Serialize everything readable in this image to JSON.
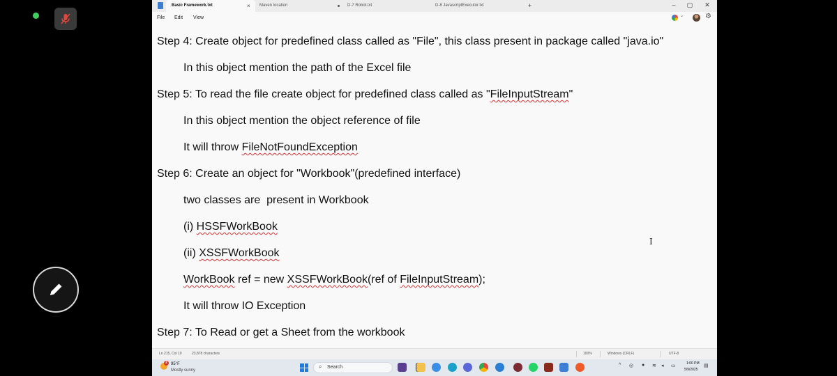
{
  "meeting": {
    "mic_icon": "mic-off-icon",
    "pen_icon": "pencil-icon",
    "colors": {
      "live_dot": "#3ecf5e",
      "mic_bg": "#3a3a3a",
      "mic_slash": "#e0483e"
    }
  },
  "notepad": {
    "tabs": [
      {
        "label": "Basic Framework.txt",
        "state": "active",
        "close": "×"
      },
      {
        "label": "Maven location",
        "state": "inactive"
      },
      {
        "label": "D-7 Robot.txt",
        "state": "modified"
      },
      {
        "label": "D-8 JavascriptExecutor.txt",
        "state": "inactive"
      }
    ],
    "new_tab_label": "+",
    "window_controls": {
      "minimize": "–",
      "maximize": "▢",
      "close": "✕"
    },
    "menu": [
      "File",
      "Edit",
      "View"
    ],
    "lines": [
      {
        "segments": [
          {
            "text": "Step 4: Create object for predefined class called as \"File\", this class present in package called \"java.io\""
          }
        ]
      },
      {
        "segments": [
          {
            "text": "In this object mention the path of the Excel file"
          }
        ]
      },
      {
        "segments": [
          {
            "text": "Step 5: To read the file create object for predefined class called as \""
          },
          {
            "text": "FileInputStream",
            "squiggle": true
          },
          {
            "text": "\""
          }
        ]
      },
      {
        "segments": [
          {
            "text": "In this object mention the object reference of file"
          }
        ]
      },
      {
        "segments": [
          {
            "text": "It will throw "
          },
          {
            "text": "FileNotFoundException",
            "squiggle": true
          }
        ]
      },
      {
        "segments": [
          {
            "text": "Step 6: Create an object for \"Workbook\"(predefined interface)"
          }
        ]
      },
      {
        "segments": [
          {
            "text": "two classes are  present in Workbook"
          }
        ]
      },
      {
        "segments": [
          {
            "text": "(i) "
          },
          {
            "text": "HSSFWorkBook",
            "squiggle": true
          }
        ]
      },
      {
        "segments": [
          {
            "text": "(ii) "
          },
          {
            "text": "XSSFWorkBook",
            "squiggle": true
          }
        ]
      },
      {
        "segments": [
          {
            "text": "WorkBook",
            "squiggle": true
          },
          {
            "text": " ref = new "
          },
          {
            "text": "XSSFWorkBook",
            "squiggle": true
          },
          {
            "text": "(ref of "
          },
          {
            "text": "FileInputStream",
            "squiggle": true
          },
          {
            "text": ");"
          }
        ]
      },
      {
        "segments": [
          {
            "text": "It will throw IO Exception"
          }
        ]
      },
      {
        "segments": [
          {
            "text": "Step 7: To Read or get a Sheet from the workbook"
          }
        ]
      }
    ],
    "status": {
      "position": "Ln 215, Col 10",
      "characters": "23,878 characters",
      "zoom": "100%",
      "line_ending": "Windows (CRLF)",
      "encoding": "UTF-8"
    }
  },
  "taskbar": {
    "weather": {
      "badge": "2",
      "temp": "95°F",
      "condition": "Mostly sunny"
    },
    "search_placeholder": "Search",
    "clock": {
      "time": "1:00 PM",
      "date": "5/9/2025"
    },
    "tray_icons": [
      "chevron-up-icon",
      "headset-icon",
      "microphone-icon",
      "wifi-icon",
      "volume-icon",
      "battery-icon",
      "notification-icon"
    ]
  }
}
